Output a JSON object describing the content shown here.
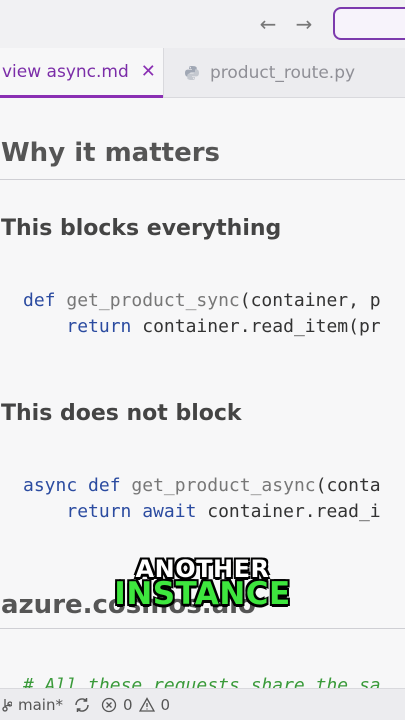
{
  "titlebar": {
    "back_icon": "←",
    "forward_icon": "→"
  },
  "tabs": [
    {
      "label": "view async.md",
      "close_icon": "✕",
      "active": true
    },
    {
      "label": "product_route.py",
      "icon": "python-icon",
      "active": false
    }
  ],
  "editor": {
    "heading_why": "Why it matters",
    "heading_blocks": "This blocks everything",
    "code_sync": {
      "line1_kw": "def",
      "line1_fn": "get_product_sync",
      "line1_rest": "(container, p",
      "line2_kw": "return",
      "line2_rest": " container.read_item(pr"
    },
    "heading_nonblock": "This does not block",
    "code_async": {
      "line1_kw": "async def",
      "line1_fn": "get_product_async",
      "line1_rest": "(conta",
      "line2_kw": "return await",
      "line2_rest": " container.read_i"
    },
    "heading_azure": "azure.cosmos.aio",
    "comment": "# All these requests share the sa"
  },
  "caption": {
    "line1": "ANOTHER",
    "line2": "INSTANCE"
  },
  "statusbar": {
    "branch": "main*",
    "errors": "0",
    "warnings": "0"
  },
  "colors": {
    "accent": "#8a2fb3",
    "keyword": "#2b4ba0",
    "comment": "#3a9a3a",
    "caption_highlight": "#3ee63e"
  }
}
